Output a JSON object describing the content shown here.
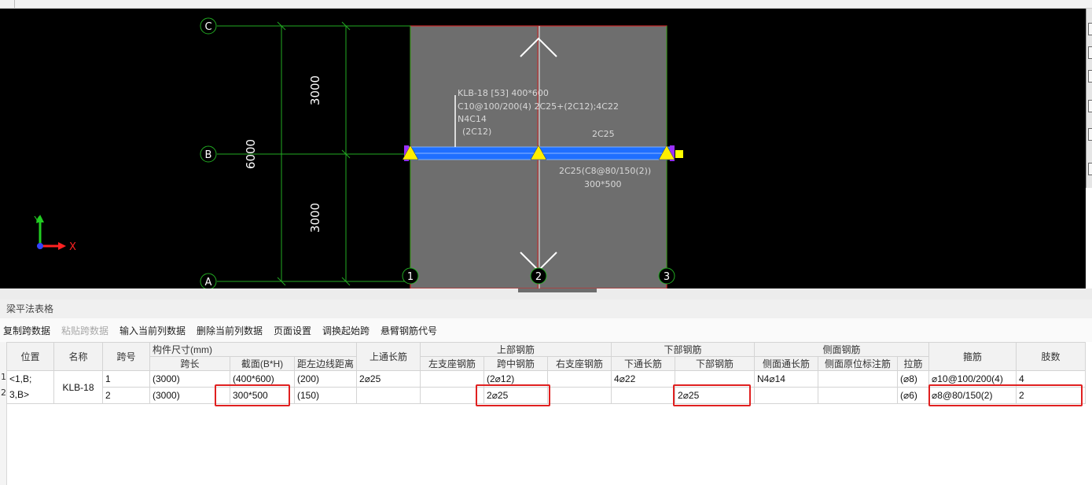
{
  "canvas": {
    "axis_labels": {
      "C": "C",
      "B": "B",
      "A": "A",
      "n1": "1",
      "n2": "2",
      "n3": "3"
    },
    "dims": {
      "top": "3000",
      "bottom": "3000",
      "total": "6000"
    },
    "beam_annotation": {
      "line1": "KLB-18 [53] 400*600",
      "line2": "C10@100/200(4) 2C25+(2C12);4C22",
      "line3": "N4C14",
      "line4": "(2C12)",
      "span_top": "2C25",
      "span_bottom1": "2C25(C8@80/150(2))",
      "span_bottom2": "300*500"
    },
    "ucs": {
      "x": "X",
      "y": "Y"
    }
  },
  "panel": {
    "title": "梁平法表格"
  },
  "toolbar": {
    "copy": "复制跨数据",
    "paste": "粘贴跨数据",
    "input_col": "输入当前列数据",
    "delete_col": "删除当前列数据",
    "page_setup": "页面设置",
    "swap_start": "调换起始跨",
    "cantilever": "悬臂钢筋代号"
  },
  "table": {
    "headers": {
      "position": "位置",
      "name": "名称",
      "span_no": "跨号",
      "dims_group": "构件尺寸(mm)",
      "span_len": "跨长",
      "section": "截面(B*H)",
      "edge_dist": "距左边线距离",
      "top_through": "上通长筋",
      "top_group": "上部钢筋",
      "left_support": "左支座钢筋",
      "mid_span": "跨中钢筋",
      "right_support": "右支座钢筋",
      "bottom_group": "下部钢筋",
      "bottom_through": "下通长筋",
      "bottom_bar": "下部钢筋",
      "side_group": "侧面钢筋",
      "side_through": "侧面通长筋",
      "side_inplace": "侧面原位标注筋",
      "tie": "拉筋",
      "stirrup": "箍筋",
      "legs": "肢数"
    },
    "row_numbers": [
      "1",
      "2"
    ],
    "position_value": "<1,B;\n3,B>",
    "position_line1": "<1,B;",
    "position_line2": "3,B>",
    "name_value": "KLB-18",
    "rows": [
      {
        "span_no": "1",
        "span_len": "(3000)",
        "section": "(400*600)",
        "edge_dist": "(200)",
        "top_through": "2⌀25",
        "left_support": "",
        "mid_span": "(2⌀12)",
        "right_support": "",
        "bottom_through": "4⌀22",
        "bottom_bar": "",
        "side_through": "N4⌀14",
        "side_inplace": "",
        "tie": "(⌀8)",
        "stirrup": "⌀10@100/200(4)",
        "legs": "4"
      },
      {
        "span_no": "2",
        "span_len": "(3000)",
        "section": "300*500",
        "edge_dist": "(150)",
        "top_through": "",
        "left_support": "",
        "mid_span": "2⌀25",
        "right_support": "",
        "bottom_through": "",
        "bottom_bar": "2⌀25",
        "side_through": "",
        "side_inplace": "",
        "tie": "(⌀6)",
        "stirrup": "⌀8@80/150(2)",
        "legs": "2"
      }
    ]
  },
  "colors": {
    "highlight": "#e02020",
    "grid_line": "#22aa22",
    "beam": "#1f6fff",
    "slab": "#6e6e6e"
  }
}
